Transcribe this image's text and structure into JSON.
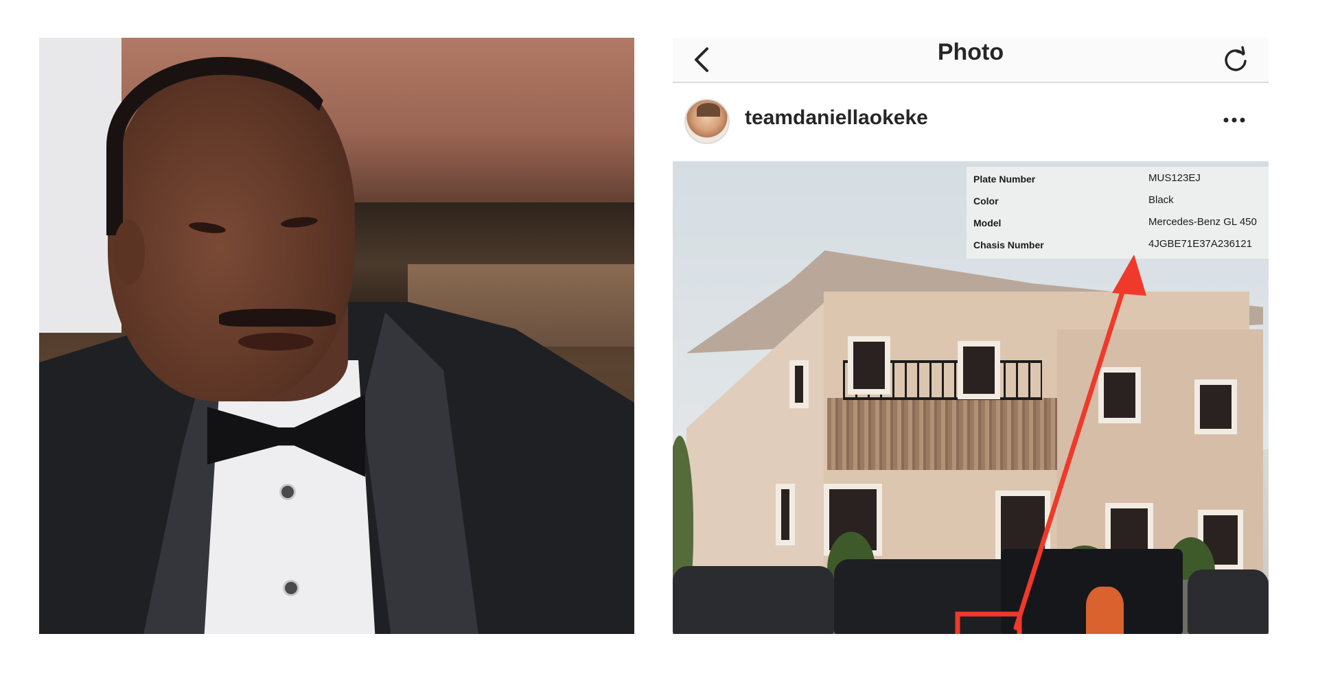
{
  "header": {
    "title": "Photo",
    "back_icon": "chevron-left-icon",
    "refresh_icon": "refresh-icon"
  },
  "post": {
    "username": "teamdaniellaokeke",
    "more_icon": "more-horizontal-icon",
    "vehicle_info": [
      {
        "label": "Plate Number",
        "value": "MUS123EJ"
      },
      {
        "label": "Color",
        "value": "Black"
      },
      {
        "label": "Model",
        "value": "Mercedes-Benz GL 450"
      },
      {
        "label": "Chasis Number",
        "value": "4JGBE71E37A236121"
      }
    ]
  },
  "colors": {
    "accent_arrow": "#f0392a",
    "header_bg": "#fafafa",
    "divider": "#dbdbdb",
    "text": "#262626"
  }
}
